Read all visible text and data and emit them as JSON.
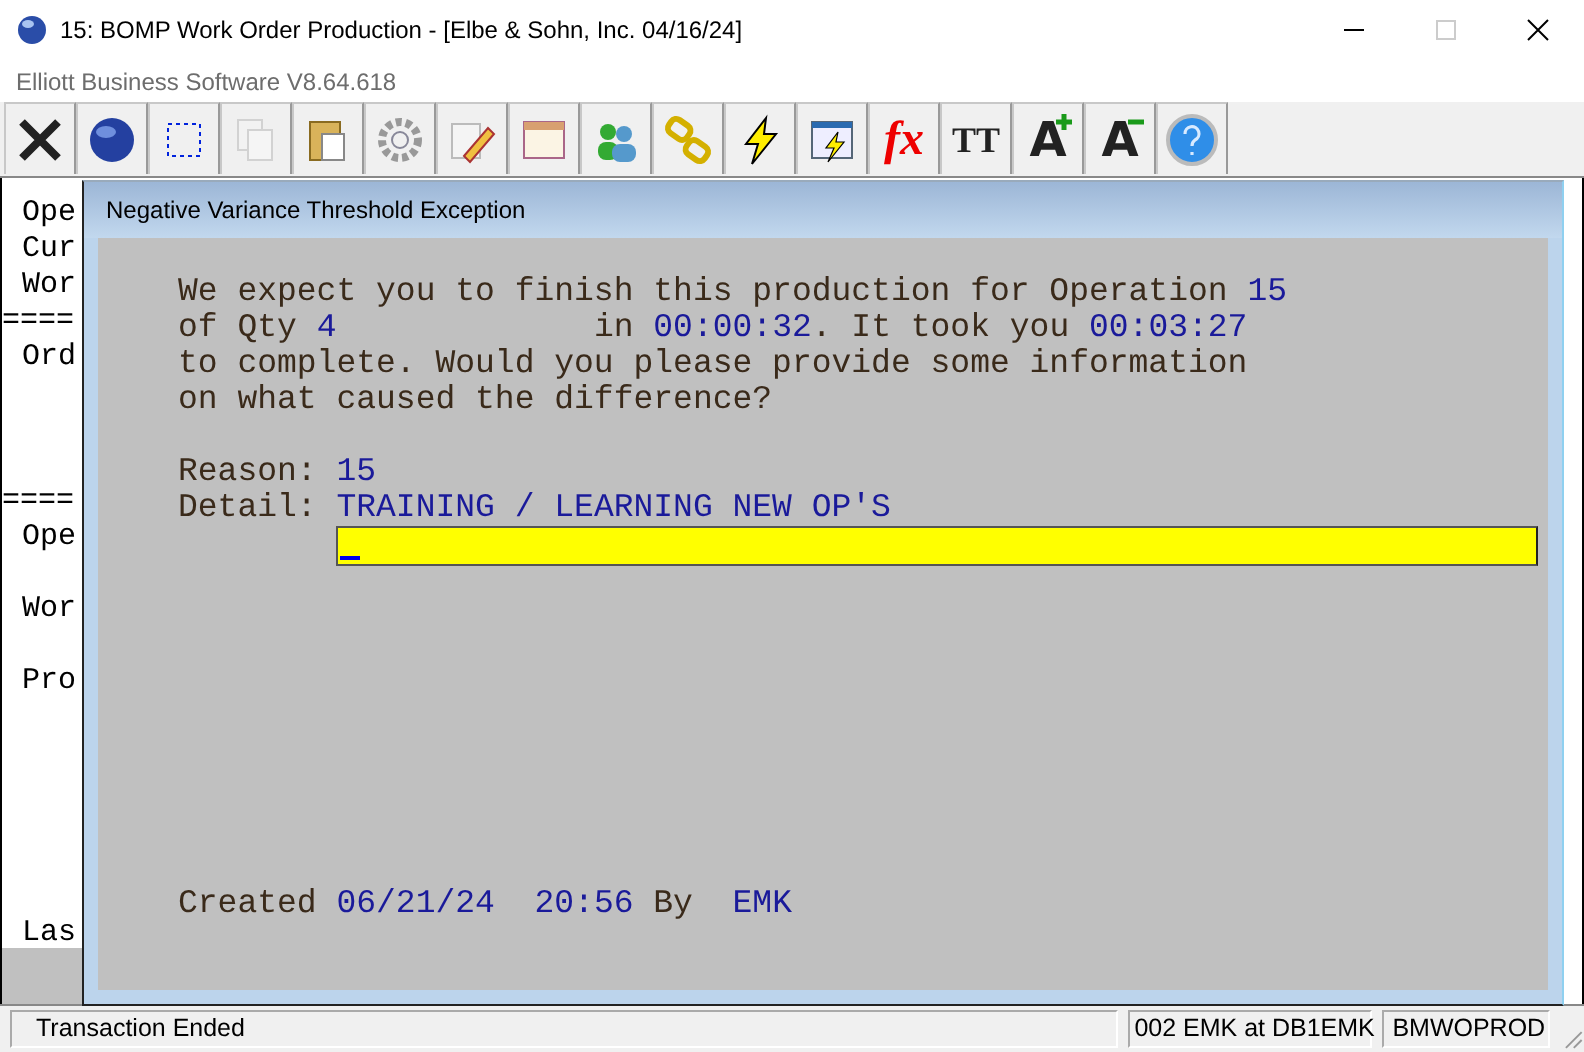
{
  "window": {
    "title": "15: BOMP Work Order Production - [Elbe & Sohn, Inc. 04/16/24]",
    "subtitle": "Elliott Business Software V8.64.618"
  },
  "toolbar": [
    {
      "kind": "cross"
    },
    {
      "kind": "globe"
    },
    {
      "kind": "select"
    },
    {
      "kind": "copy",
      "disabled": true
    },
    {
      "kind": "paste",
      "disabled": false
    },
    {
      "kind": "gear",
      "disabled": false
    },
    {
      "kind": "edit"
    },
    {
      "kind": "ledger"
    },
    {
      "kind": "users"
    },
    {
      "kind": "chain"
    },
    {
      "kind": "bolt"
    },
    {
      "kind": "window-bolt"
    },
    {
      "kind": "glyph-fx",
      "glyph": "fx"
    },
    {
      "kind": "glyph-tt",
      "glyph": "TT"
    },
    {
      "kind": "font-up",
      "glyph": "A"
    },
    {
      "kind": "font-down",
      "glyph": "A"
    },
    {
      "kind": "help"
    }
  ],
  "background_lines": [
    {
      "text": "Ope"
    },
    {
      "text": "Cur"
    },
    {
      "text": "Wor"
    },
    {
      "text": "===="
    },
    {
      "text": "Ord"
    },
    {
      "text": "===="
    },
    {
      "text": "Ope"
    },
    {
      "text": "Wor"
    },
    {
      "text": "Pro"
    },
    {
      "text": "Las"
    }
  ],
  "dialog": {
    "title": "Negative Variance Threshold Exception",
    "message_lines": [
      [
        {
          "kind": "label",
          "text": "We expect you to finish this production for Operation "
        },
        {
          "kind": "value",
          "text": "15"
        }
      ],
      [
        {
          "kind": "label",
          "text": "of Qty "
        },
        {
          "kind": "value",
          "text": "4"
        },
        {
          "kind": "label",
          "text": "             in "
        },
        {
          "kind": "value",
          "text": "00:00:32"
        },
        {
          "kind": "label",
          "text": ". It took you "
        },
        {
          "kind": "value",
          "text": "00:03:27"
        }
      ],
      [
        {
          "kind": "label",
          "text": "to complete. Would you please provide some information"
        }
      ],
      [
        {
          "kind": "label",
          "text": "on what caused the difference?"
        }
      ]
    ],
    "reason": {
      "label": "Reason:",
      "value": "15"
    },
    "detail": {
      "label": "Detail:",
      "value": "TRAINING / LEARNING NEW OP'S"
    },
    "detail_input": {
      "focused": true
    },
    "created_line": [
      {
        "kind": "label",
        "text": "Created "
      },
      {
        "kind": "value",
        "text": "06/21/24"
      },
      {
        "kind": "value",
        "text": "20:56"
      },
      {
        "kind": "label",
        "text": " By  "
      },
      {
        "kind": "value",
        "text": "EMK"
      }
    ]
  },
  "status_bar": {
    "message": "Transaction Ended",
    "user": "002 EMK at DB1EMK",
    "program": "BMWOPROD"
  }
}
